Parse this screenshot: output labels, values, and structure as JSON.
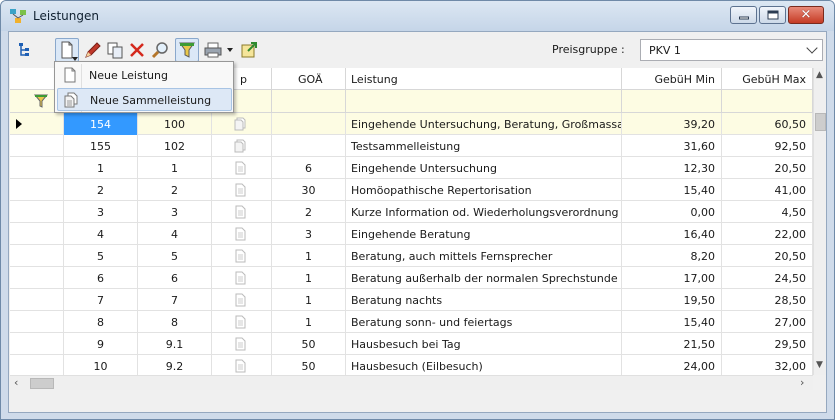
{
  "window": {
    "title": "Leistungen",
    "app_icon": "network-tree-icon"
  },
  "toolbar": {
    "buttons": [
      {
        "name": "tree-view",
        "icon": "tree-icon"
      },
      {
        "name": "new",
        "icon": "new-document-icon"
      },
      {
        "name": "edit",
        "icon": "pencil-icon"
      },
      {
        "name": "copy",
        "icon": "copy-icon"
      },
      {
        "name": "delete",
        "icon": "delete-x-icon"
      },
      {
        "name": "search",
        "icon": "magnifier-icon"
      },
      {
        "name": "filter",
        "icon": "funnel-icon"
      },
      {
        "name": "print",
        "icon": "printer-icon"
      },
      {
        "name": "export",
        "icon": "export-icon"
      }
    ],
    "preisgruppe_label": "Preisgruppe :",
    "preisgruppe_value": "PKV 1"
  },
  "menu": {
    "items": [
      {
        "label": "Neue Leistung",
        "icon": "document-icon"
      },
      {
        "label": "Neue Sammelleistung",
        "icon": "documents-stack-icon"
      }
    ]
  },
  "grid": {
    "columns": [
      "",
      "",
      "p",
      "GOÄ",
      "Leistung",
      "GebüH Min",
      "GebüH Max"
    ],
    "rows": [
      {
        "id": "154",
        "nr": "100",
        "goa": "",
        "leistung": "Eingehende Untersuchung, Beratung, Großmassage",
        "min": "39,20",
        "max": "60,50",
        "type": "sammel"
      },
      {
        "id": "155",
        "nr": "102",
        "goa": "",
        "leistung": "Testsammelleistung",
        "min": "31,60",
        "max": "92,50",
        "type": "sammel"
      },
      {
        "id": "1",
        "nr": "1",
        "goa": "6",
        "leistung": "Eingehende Untersuchung",
        "min": "12,30",
        "max": "20,50",
        "type": "single"
      },
      {
        "id": "2",
        "nr": "2",
        "goa": "30",
        "leistung": "Homöopathische Repertorisation",
        "min": "15,40",
        "max": "41,00",
        "type": "single"
      },
      {
        "id": "3",
        "nr": "3",
        "goa": "2",
        "leistung": "Kurze Information od. Wiederholungsverordnung",
        "min": "0,00",
        "max": "4,50",
        "type": "single"
      },
      {
        "id": "4",
        "nr": "4",
        "goa": "3",
        "leistung": "Eingehende Beratung",
        "min": "16,40",
        "max": "22,00",
        "type": "single"
      },
      {
        "id": "5",
        "nr": "5",
        "goa": "1",
        "leistung": "Beratung, auch mittels Fernsprecher",
        "min": "8,20",
        "max": "20,50",
        "type": "single"
      },
      {
        "id": "6",
        "nr": "6",
        "goa": "1",
        "leistung": "Beratung außerhalb der normalen Sprechstunde",
        "min": "17,00",
        "max": "24,50",
        "type": "single"
      },
      {
        "id": "7",
        "nr": "7",
        "goa": "1",
        "leistung": "Beratung nachts",
        "min": "19,50",
        "max": "28,50",
        "type": "single"
      },
      {
        "id": "8",
        "nr": "8",
        "goa": "1",
        "leistung": "Beratung sonn- und feiertags",
        "min": "15,40",
        "max": "27,00",
        "type": "single"
      },
      {
        "id": "9",
        "nr": "9.1",
        "goa": "50",
        "leistung": "Hausbesuch bei Tag",
        "min": "21,50",
        "max": "29,50",
        "type": "single"
      },
      {
        "id": "10",
        "nr": "9.2",
        "goa": "50",
        "leistung": "Hausbesuch (Eilbesuch)",
        "min": "24,00",
        "max": "32,00",
        "type": "single"
      }
    ],
    "selected_row": 0
  },
  "colors": {
    "selection": "#3399ff",
    "filter_row": "#fdfce3",
    "title_bar": "#c5d5e8"
  }
}
